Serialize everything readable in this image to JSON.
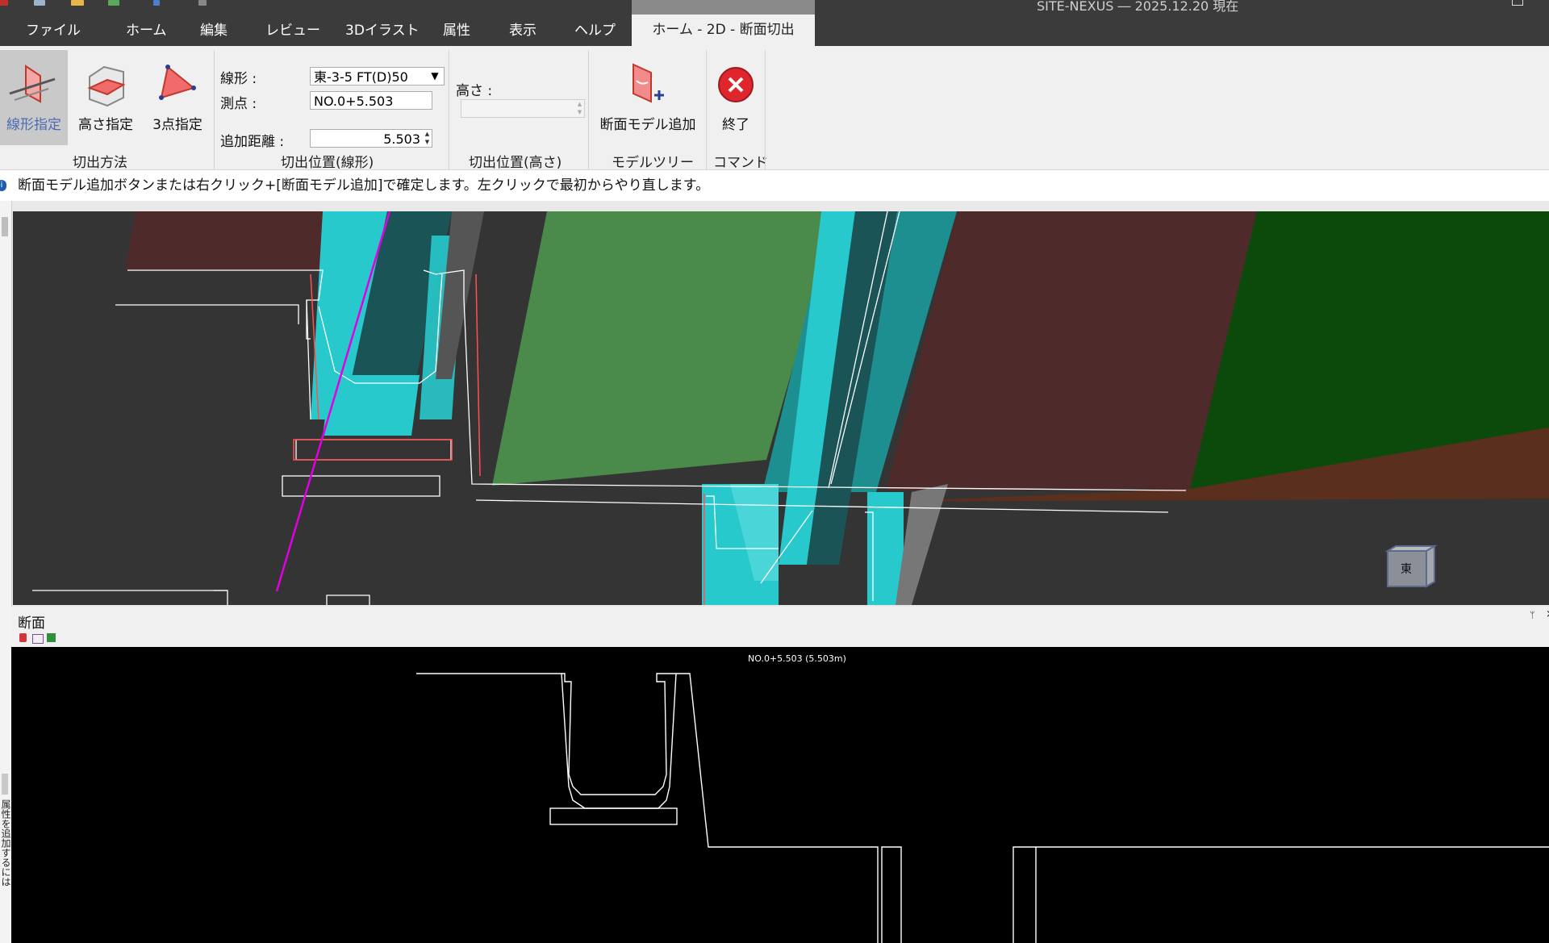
{
  "menu": {
    "tabs": [
      "ファイル",
      "ホーム",
      "編集",
      "レビュー",
      "3Dイラスト",
      "属性",
      "表示",
      "ヘルプ"
    ],
    "context_tab": "ホーム - 2D - 断面切出",
    "app_title": "SITE-NEXUS ― 2025.12.20 現在"
  },
  "ribbon": {
    "cut_method": {
      "buttons": [
        "線形指定",
        "高さ指定",
        "3点指定"
      ],
      "active": "線形指定",
      "group_label": "切出方法"
    },
    "cut_position_alignment": {
      "alignment_label": "線形 :",
      "alignment_value": "東-3-5 FT(D)50",
      "station_label": "測点 :",
      "station_value": "NO.0+5.503",
      "add_distance_label": "追加距離 :",
      "add_distance_value": "5.503",
      "group_label": "切出位置(線形)"
    },
    "cut_position_height": {
      "height_label": "高さ :",
      "height_value": "",
      "group_label": "切出位置(高さ)"
    },
    "model_tree": {
      "button_label": "断面モデル追加",
      "group_label": "モデルツリー"
    },
    "command": {
      "button_label": "終了",
      "group_label": "コマンド"
    }
  },
  "info_message": "断面モデル追加ボタンまたは右クリック+[断面モデル追加]で確定します。左クリックで最初からやり直します。",
  "navcube": {
    "face_label": "東"
  },
  "section_panel": {
    "title": "断面",
    "view_label": "NO.0+5.503 (5.503m)"
  },
  "side_panel_text": "属性を追加するには",
  "colors": {
    "menubar": "#3b3b3b",
    "ribbon": "#f0f0f0",
    "cyan": "#27c9cc",
    "green_plane": "#4a8a4a",
    "brown_plane": "#4e2a2a",
    "dark_green": "#0c4a0c",
    "magenta_line": "#e100e1",
    "close_red": "#e0262d"
  }
}
